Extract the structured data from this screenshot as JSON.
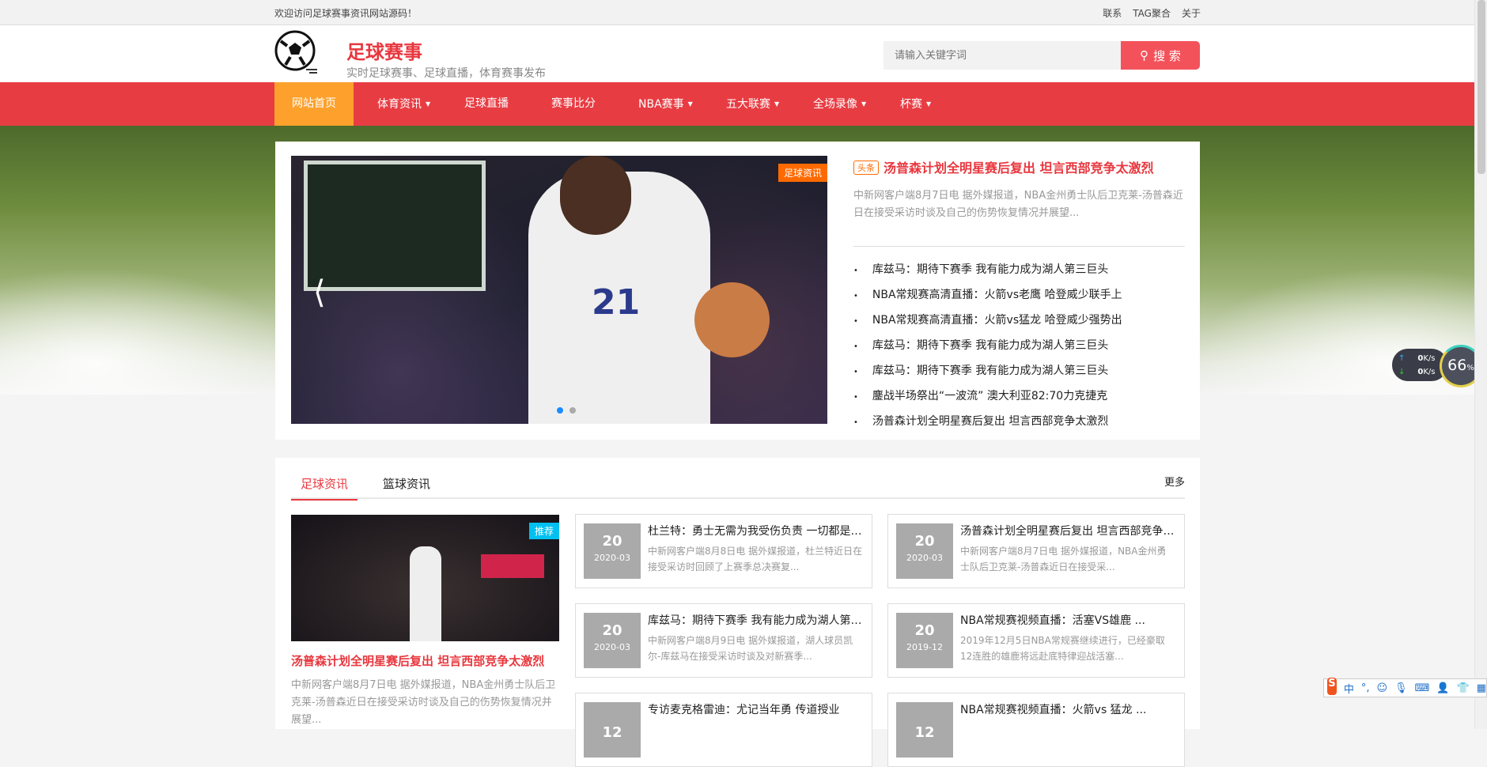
{
  "topbar": {
    "welcome": "欢迎访问足球赛事资讯网站源码！",
    "links": [
      "联系",
      "TAG聚合",
      "关于"
    ]
  },
  "header": {
    "title": "足球赛事",
    "slogan": "实时足球赛事、足球直播，体育赛事发布",
    "search_placeholder": "请输入关键字词",
    "search_label": "搜 索"
  },
  "nav": [
    {
      "label": "网站首页"
    },
    {
      "label": "体育资讯",
      "dropdown": true
    },
    {
      "label": "足球直播"
    },
    {
      "label": "赛事比分"
    },
    {
      "label": "NBA赛事",
      "dropdown": true
    },
    {
      "label": "五大联赛",
      "dropdown": true
    },
    {
      "label": "全场录像",
      "dropdown": true
    },
    {
      "label": "杯赛",
      "dropdown": true
    }
  ],
  "banner": {
    "slider_tag": "足球资讯",
    "jersey_number": "21",
    "headline_tag": "头条",
    "headline": "汤普森计划全明星赛后复出 坦言西部竞争太激烈",
    "summary": "中新网客户端8月7日电 据外媒报道，NBA金州勇士队后卫克莱-汤普森近日在接受采访时谈及自己的伤势恢复情况并展望...",
    "list": [
      "库兹马：期待下赛季 我有能力成为湖人第三巨头",
      "NBA常规赛高清直播：火箭vs老鹰 哈登威少联手上",
      "NBA常规赛高清直播：火箭vs猛龙 哈登威少强势出",
      "库兹马：期待下赛季 我有能力成为湖人第三巨头",
      "库兹马：期待下赛季 我有能力成为湖人第三巨头",
      "鏖战半场祭出“一波流” 澳大利亚82:70力克捷克",
      "汤普森计划全明星赛后复出 坦言西部竞争太激烈"
    ]
  },
  "news": {
    "tabs": [
      "足球资讯",
      "篮球资讯"
    ],
    "more": "更多",
    "feature": {
      "badge": "推荐",
      "title": "汤普森计划全明星赛后复出 坦言西部竞争太激烈",
      "summary": "中新网客户端8月7日电 据外媒报道，NBA金州勇士队后卫克莱-汤普森近日在接受采访时谈及自己的伤势恢复情况并展望..."
    },
    "items": [
      {
        "day": "20",
        "ym": "2020-03",
        "title": "杜兰特：勇士无需为我受伤负责 一切都是命运",
        "summary": "中新网客户端8月8日电 据外媒报道，杜兰特近日在接受采访时回顾了上赛季总决赛复..."
      },
      {
        "day": "20",
        "ym": "2020-03",
        "title": "汤普森计划全明星赛后复出 坦言西部竞争太激烈",
        "summary": "中新网客户端8月7日电 据外媒报道，NBA金州勇士队后卫克莱-汤普森近日在接受采..."
      },
      {
        "day": "20",
        "ym": "2020-03",
        "title": "库兹马：期待下赛季 我有能力成为湖人第三巨头",
        "summary": "中新网客户端8月9日电 据外媒报道，湖人球员凯尔-库兹马在接受采访时谈及对新赛季..."
      },
      {
        "day": "20",
        "ym": "2019-12",
        "title": "NBA常规赛视频直播：活塞VS雄鹿 ...",
        "summary": "2019年12月5日NBA常规赛继续进行，已经豪取12连胜的雄鹿将远赴底特律迎战活塞..."
      },
      {
        "day": "12",
        "ym": "",
        "title": "专访麦克格雷迪：尤记当年勇 传道授业",
        "summary": ""
      },
      {
        "day": "12",
        "ym": "",
        "title": "NBA常规赛视频直播：火箭vs 猛龙 ...",
        "summary": ""
      }
    ]
  },
  "widget": {
    "up": "0",
    "down": "0",
    "unit": "K/s",
    "percent": "66",
    "percent_sign": "%"
  },
  "ime": {
    "mode": "中",
    "punct": "°,"
  }
}
